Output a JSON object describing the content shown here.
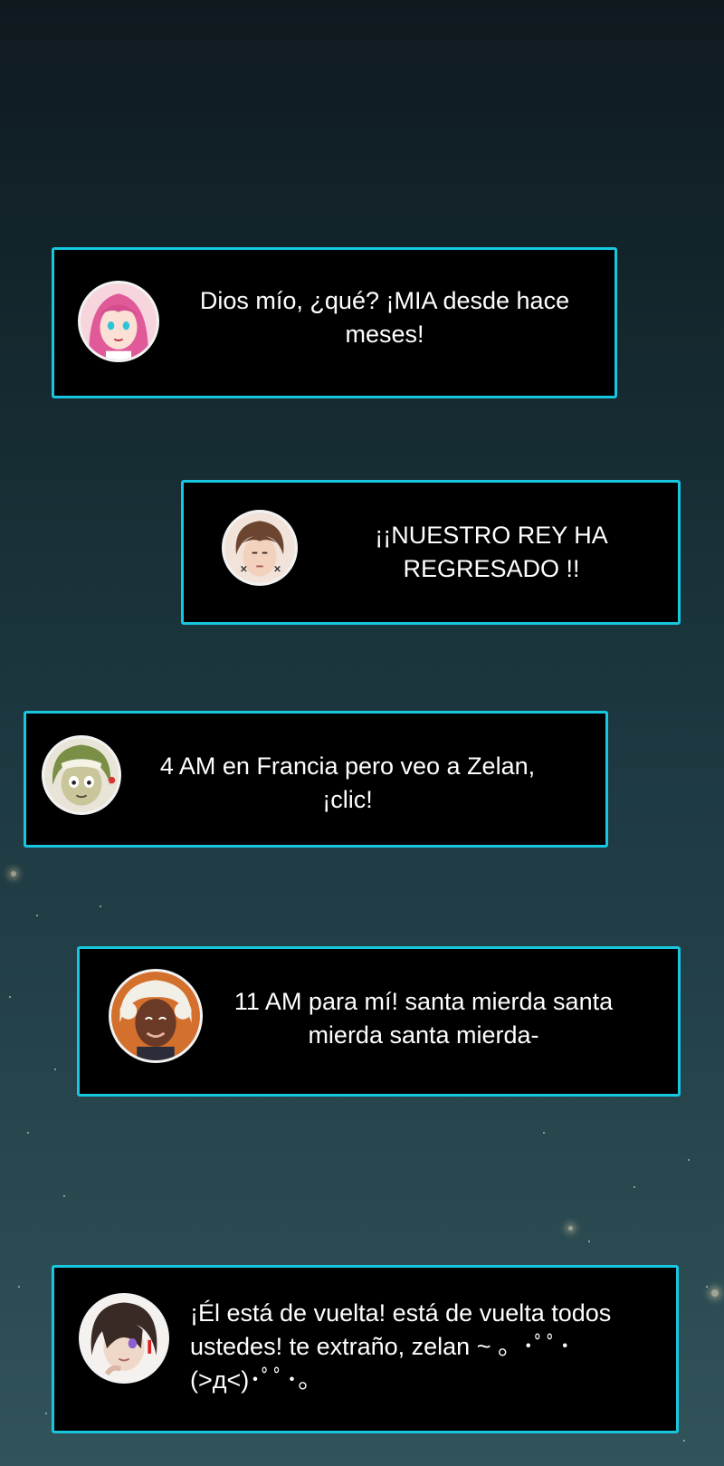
{
  "messages": [
    {
      "avatar": "pink-hair-girl-avatar-icon",
      "text": "Dios mío, ¿qué? ¡MIA desde hace meses!"
    },
    {
      "avatar": "brown-hair-man-avatar-icon",
      "text": "¡¡NUESTRO REY HA REGRESADO !!"
    },
    {
      "avatar": "green-hair-boy-avatar-icon",
      "text": "4 AM en Francia pero veo a Zelan, ¡clic!"
    },
    {
      "avatar": "white-hair-woman-avatar-icon",
      "text": "11 AM para mí! santa mierda santa mierda santa mierda-"
    },
    {
      "avatar": "dark-hair-boy-avatar-icon",
      "text": "¡Él está de vuelta! está de vuelta todos ustedes! te extraño, zelan ~ 。･ﾟﾟ･(>д<)･ﾟﾟ･。"
    }
  ],
  "colors": {
    "border": "#18c6e0",
    "bubble": "#000000",
    "text": "#ffffff"
  }
}
